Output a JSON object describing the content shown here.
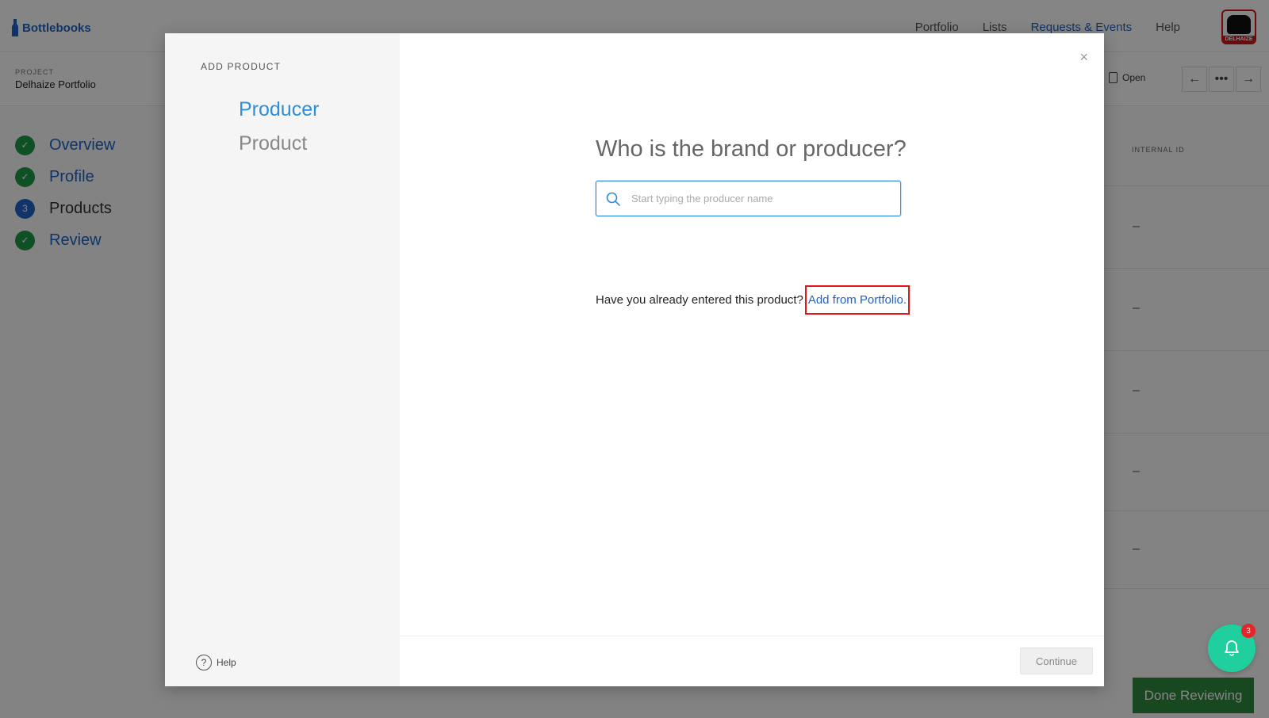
{
  "app": {
    "brand": "Bottlebooks",
    "nav": [
      "Portfolio",
      "Lists",
      "Requests & Events",
      "Help"
    ],
    "logo_text": "DELHAIZE",
    "project_label": "PROJECT",
    "project_name": "Delhaize Portfolio",
    "open_label": "Open",
    "steps": [
      {
        "label": "Overview",
        "badge": "✓"
      },
      {
        "label": "Profile",
        "badge": "✓"
      },
      {
        "label": "Products",
        "badge": "3"
      },
      {
        "label": "Review",
        "badge": "✓"
      }
    ],
    "column_internal_id": "INTERNAL ID",
    "row_values": [
      "–",
      "–",
      "–",
      "–",
      "–"
    ],
    "done_button": "Done Reviewing",
    "notification_count": "3"
  },
  "modal": {
    "side_title": "ADD PRODUCT",
    "side_steps": [
      "Producer",
      "Product"
    ],
    "help_label": "Help",
    "question": "Who is the brand or producer?",
    "search_placeholder": "Start typing the producer name",
    "portfolio_prompt": "Have you already entered this product?",
    "portfolio_link": "Add from Portfolio.",
    "continue_label": "Continue",
    "close_glyph": "×"
  },
  "colors": {
    "accent_blue": "#1f63c7",
    "step_active": "#2b8fd9",
    "done_green": "#2e8b3d",
    "bell_teal": "#1fcf9e",
    "highlight_red": "#e01818"
  }
}
